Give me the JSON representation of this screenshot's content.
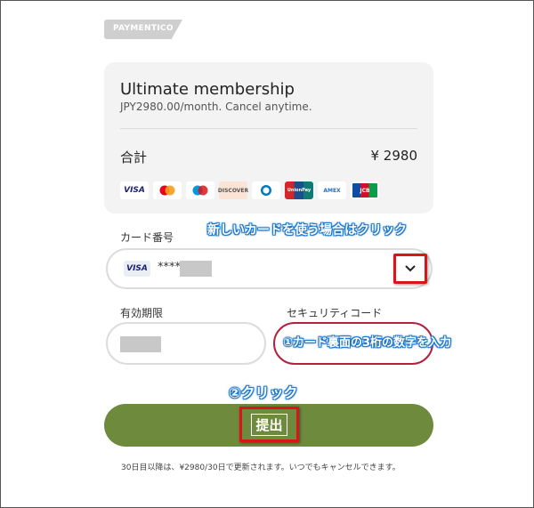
{
  "brand": {
    "logo_text": "PAYMENTICO"
  },
  "summary": {
    "product_title": "Ultimate membership",
    "product_subtitle": "JPY2980.00/month. Cancel anytime.",
    "total_label": "合計",
    "total_value": "¥ 2980",
    "card_brands": [
      "VISA",
      "mastercard",
      "maestro",
      "DISCOVER",
      "diners",
      "UnionPay",
      "AMEX",
      "JCB"
    ]
  },
  "annotations": {
    "new_card": "新しいカードを使う場合はクリック",
    "cvc_hint": "①カード裏面の3桁の数字を入力",
    "step2": "②クリック"
  },
  "form": {
    "card_label": "カード番号",
    "card_brand": "VISA",
    "card_mask": "****",
    "expiry_label": "有効期限",
    "cvc_label": "セキュリティコード",
    "submit_label": "提出"
  },
  "footer_text": "30日目以降は、¥2980/30日で更新されます。いつでもキャンセルできます。",
  "colors": {
    "submit": "#6e8a3d",
    "highlight": "#d9151b",
    "annotation": "#1f78c8",
    "cvc_border": "#b3213d"
  }
}
